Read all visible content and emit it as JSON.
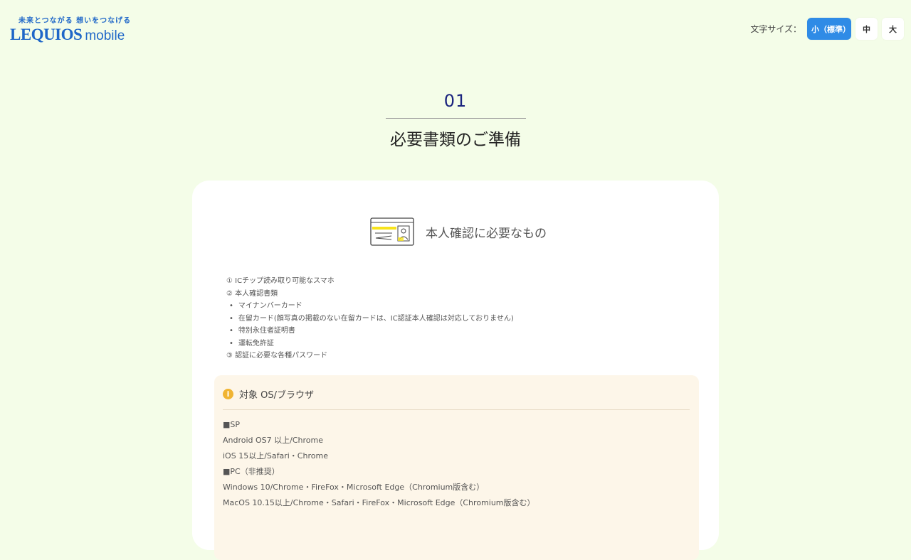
{
  "header": {
    "logo_tagline": "未来とつながる 想いをつなげる",
    "logo_main": "LEQUIOS",
    "logo_sub": "mobile",
    "font_size_label": "文字サイズ：",
    "font_size_options": [
      "小（標準）",
      "中",
      "大"
    ],
    "accent_color": "#2f8be6"
  },
  "step": {
    "number": "01",
    "title": "必要書類のご準備"
  },
  "card": {
    "icon": "id-card-icon",
    "title": "本人確認に必要なもの",
    "items": [
      "① ICチップ読み取り可能なスマホ",
      "② 本人確認書類"
    ],
    "documents": [
      "マイナンバーカード",
      "在留カード(顔写真の掲載のない在留カードは、IC認証本人確認は対応しておりません)",
      "特別永住者証明書",
      "運転免許証"
    ],
    "item3": "③ 認証に必要な各種パスワード"
  },
  "os_box": {
    "icon": "info-icon",
    "title": "対象 OS/ブラウザ",
    "lines": [
      "■SP",
      "Android OS7 以上/Chrome",
      "iOS 15以上/Safari・Chrome",
      "■PC（非推奨）",
      "Windows 10/Chrome・FireFox・Microsoft Edge（Chromium版含む）",
      "MacOS 10.15以上/Chrome・Safari・FireFox・Microsoft Edge（Chromium版含む）"
    ]
  }
}
